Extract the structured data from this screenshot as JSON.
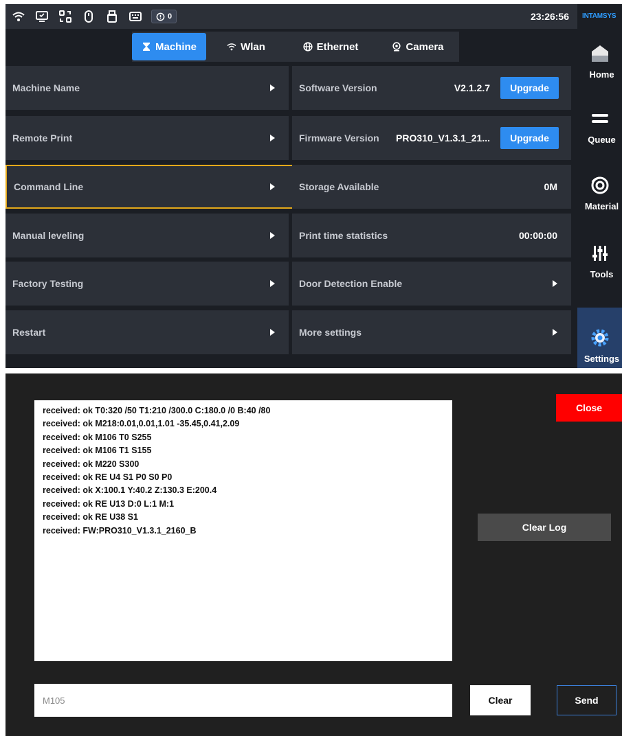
{
  "status_bar": {
    "alert_count": "0",
    "time": "23:26:56",
    "brand": "INTAMSYS"
  },
  "tabs": [
    {
      "label": "Machine",
      "icon": "hourglass-icon",
      "active": true
    },
    {
      "label": "Wlan",
      "icon": "wifi-icon",
      "active": false
    },
    {
      "label": "Ethernet",
      "icon": "globe-icon",
      "active": false
    },
    {
      "label": "Camera",
      "icon": "camera-icon",
      "active": false
    }
  ],
  "left_items": [
    {
      "label": "Machine Name"
    },
    {
      "label": "Remote Print"
    },
    {
      "label": "Command Line",
      "selected": true
    },
    {
      "label": "Manual leveling"
    },
    {
      "label": "Factory Testing"
    },
    {
      "label": "Restart"
    }
  ],
  "right_items": [
    {
      "label": "Software Version",
      "value": "V2.1.2.7",
      "button": "Upgrade"
    },
    {
      "label": "Firmware Version",
      "value": "PRO310_V1.3.1_21...",
      "button": "Upgrade"
    },
    {
      "label": "Storage Available",
      "value": "0M"
    },
    {
      "label": "Print time statistics",
      "value": "00:00:00"
    },
    {
      "label": "Door Detection Enable"
    },
    {
      "label": "More settings"
    }
  ],
  "sidenav": [
    {
      "label": "Home",
      "icon": "home-icon"
    },
    {
      "label": "Queue",
      "icon": "menu-icon"
    },
    {
      "label": "Material",
      "icon": "spool-icon"
    },
    {
      "label": "Tools",
      "icon": "sliders-icon"
    },
    {
      "label": "Settings",
      "icon": "gear-icon",
      "active": true
    }
  ],
  "console": {
    "log_lines": [
      "received: ok T0:320 /50 T1:210 /300.0 C:180.0 /0 B:40 /80",
      "received: ok M218:0.01,0.01,1.01 -35.45,0.41,2.09",
      "received: ok M106 T0 S255",
      "received: ok M106 T1 S155",
      "received: ok M220 S300",
      "received: ok RE U4 S1 P0 S0 P0",
      "received: ok X:100.1 Y:40.2 Z:130.3 E:200.4",
      "received: ok RE U13 D:0 L:1 M:1",
      "received: ok RE U38 S1",
      "received: FW:PRO310_V1.3.1_2160_B"
    ],
    "close_label": "Close",
    "clear_log_label": "Clear Log",
    "input_value": "M105",
    "clear_label": "Clear",
    "send_label": "Send",
    "accent_red": "#ff0000"
  }
}
